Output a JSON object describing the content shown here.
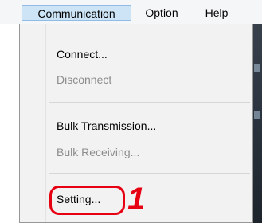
{
  "menubar": {
    "items": [
      {
        "label": "Communication"
      },
      {
        "label": "Option"
      },
      {
        "label": "Help"
      }
    ]
  },
  "menu": {
    "items": [
      {
        "label": "Connect...",
        "enabled": true
      },
      {
        "label": "Disconnect",
        "enabled": false
      },
      {
        "label": "Bulk Transmission...",
        "enabled": true
      },
      {
        "label": "Bulk Receiving...",
        "enabled": false
      },
      {
        "label": "Setting...",
        "enabled": true
      }
    ]
  },
  "annotation": {
    "step_number": "1",
    "color": "#e60012"
  }
}
